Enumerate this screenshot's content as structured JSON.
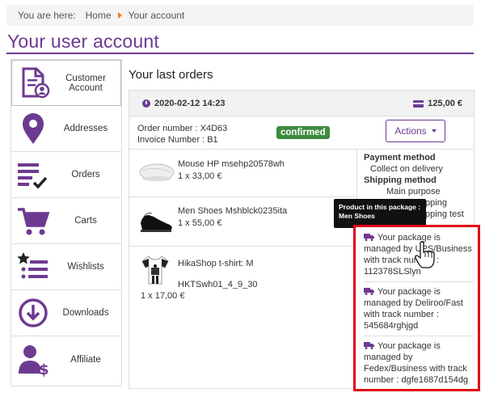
{
  "breadcrumb": {
    "label": "You are here:",
    "home": "Home",
    "current": "Your account"
  },
  "page": {
    "title": "Your user account"
  },
  "sidebar": {
    "items": [
      {
        "label": "Customer Account",
        "icon": "user-doc-icon"
      },
      {
        "label": "Addresses",
        "icon": "map-pin-icon"
      },
      {
        "label": "Orders",
        "icon": "orders-check-icon"
      },
      {
        "label": "Carts",
        "icon": "cart-icon"
      },
      {
        "label": "Wishlists",
        "icon": "wishlist-star-icon"
      },
      {
        "label": "Downloads",
        "icon": "download-icon"
      },
      {
        "label": "Affiliate",
        "icon": "affiliate-user-icon"
      }
    ]
  },
  "orders": {
    "title": "Your last orders",
    "date": "2020-02-12 14:23",
    "total": "125,00 €",
    "order_number": "Order number : X4D63",
    "invoice_number": "Invoice Number : B1",
    "status": "confirmed",
    "actions_label": "Actions",
    "products": [
      {
        "name": "Mouse HP msehp20578wh",
        "qty": "1 x 33,00 €"
      },
      {
        "name": "Men Shoes Mshblck0235ita",
        "qty": "1 x 55,00 €"
      },
      {
        "name": "HikaShop t-shirt: M",
        "code": "HKTSwh01_4_9_30",
        "qty": "1 x 17,00 €"
      }
    ],
    "payment_title": "Payment method",
    "payment_value": "Collect on delivery",
    "shipping_title": "Shipping method",
    "shipping_values": [
      "Main purpose",
      "shipping",
      "shipping test"
    ],
    "tooltip_line1": "Product in this package :",
    "tooltip_line2": "Men Shoes",
    "packages": [
      {
        "text": "Your package is managed by UPS/Business with track number : 112378SLSlyn"
      },
      {
        "text": "Your package is managed by Deliroo/Fast with track number : 545684rghjgd"
      },
      {
        "text": "Your package is managed by Fedex/Business with track number : dgfe1687d154dg"
      }
    ]
  },
  "colors": {
    "brand": "#6d3a91",
    "status_ok": "#3d8b40",
    "highlight": "#e2001a"
  }
}
